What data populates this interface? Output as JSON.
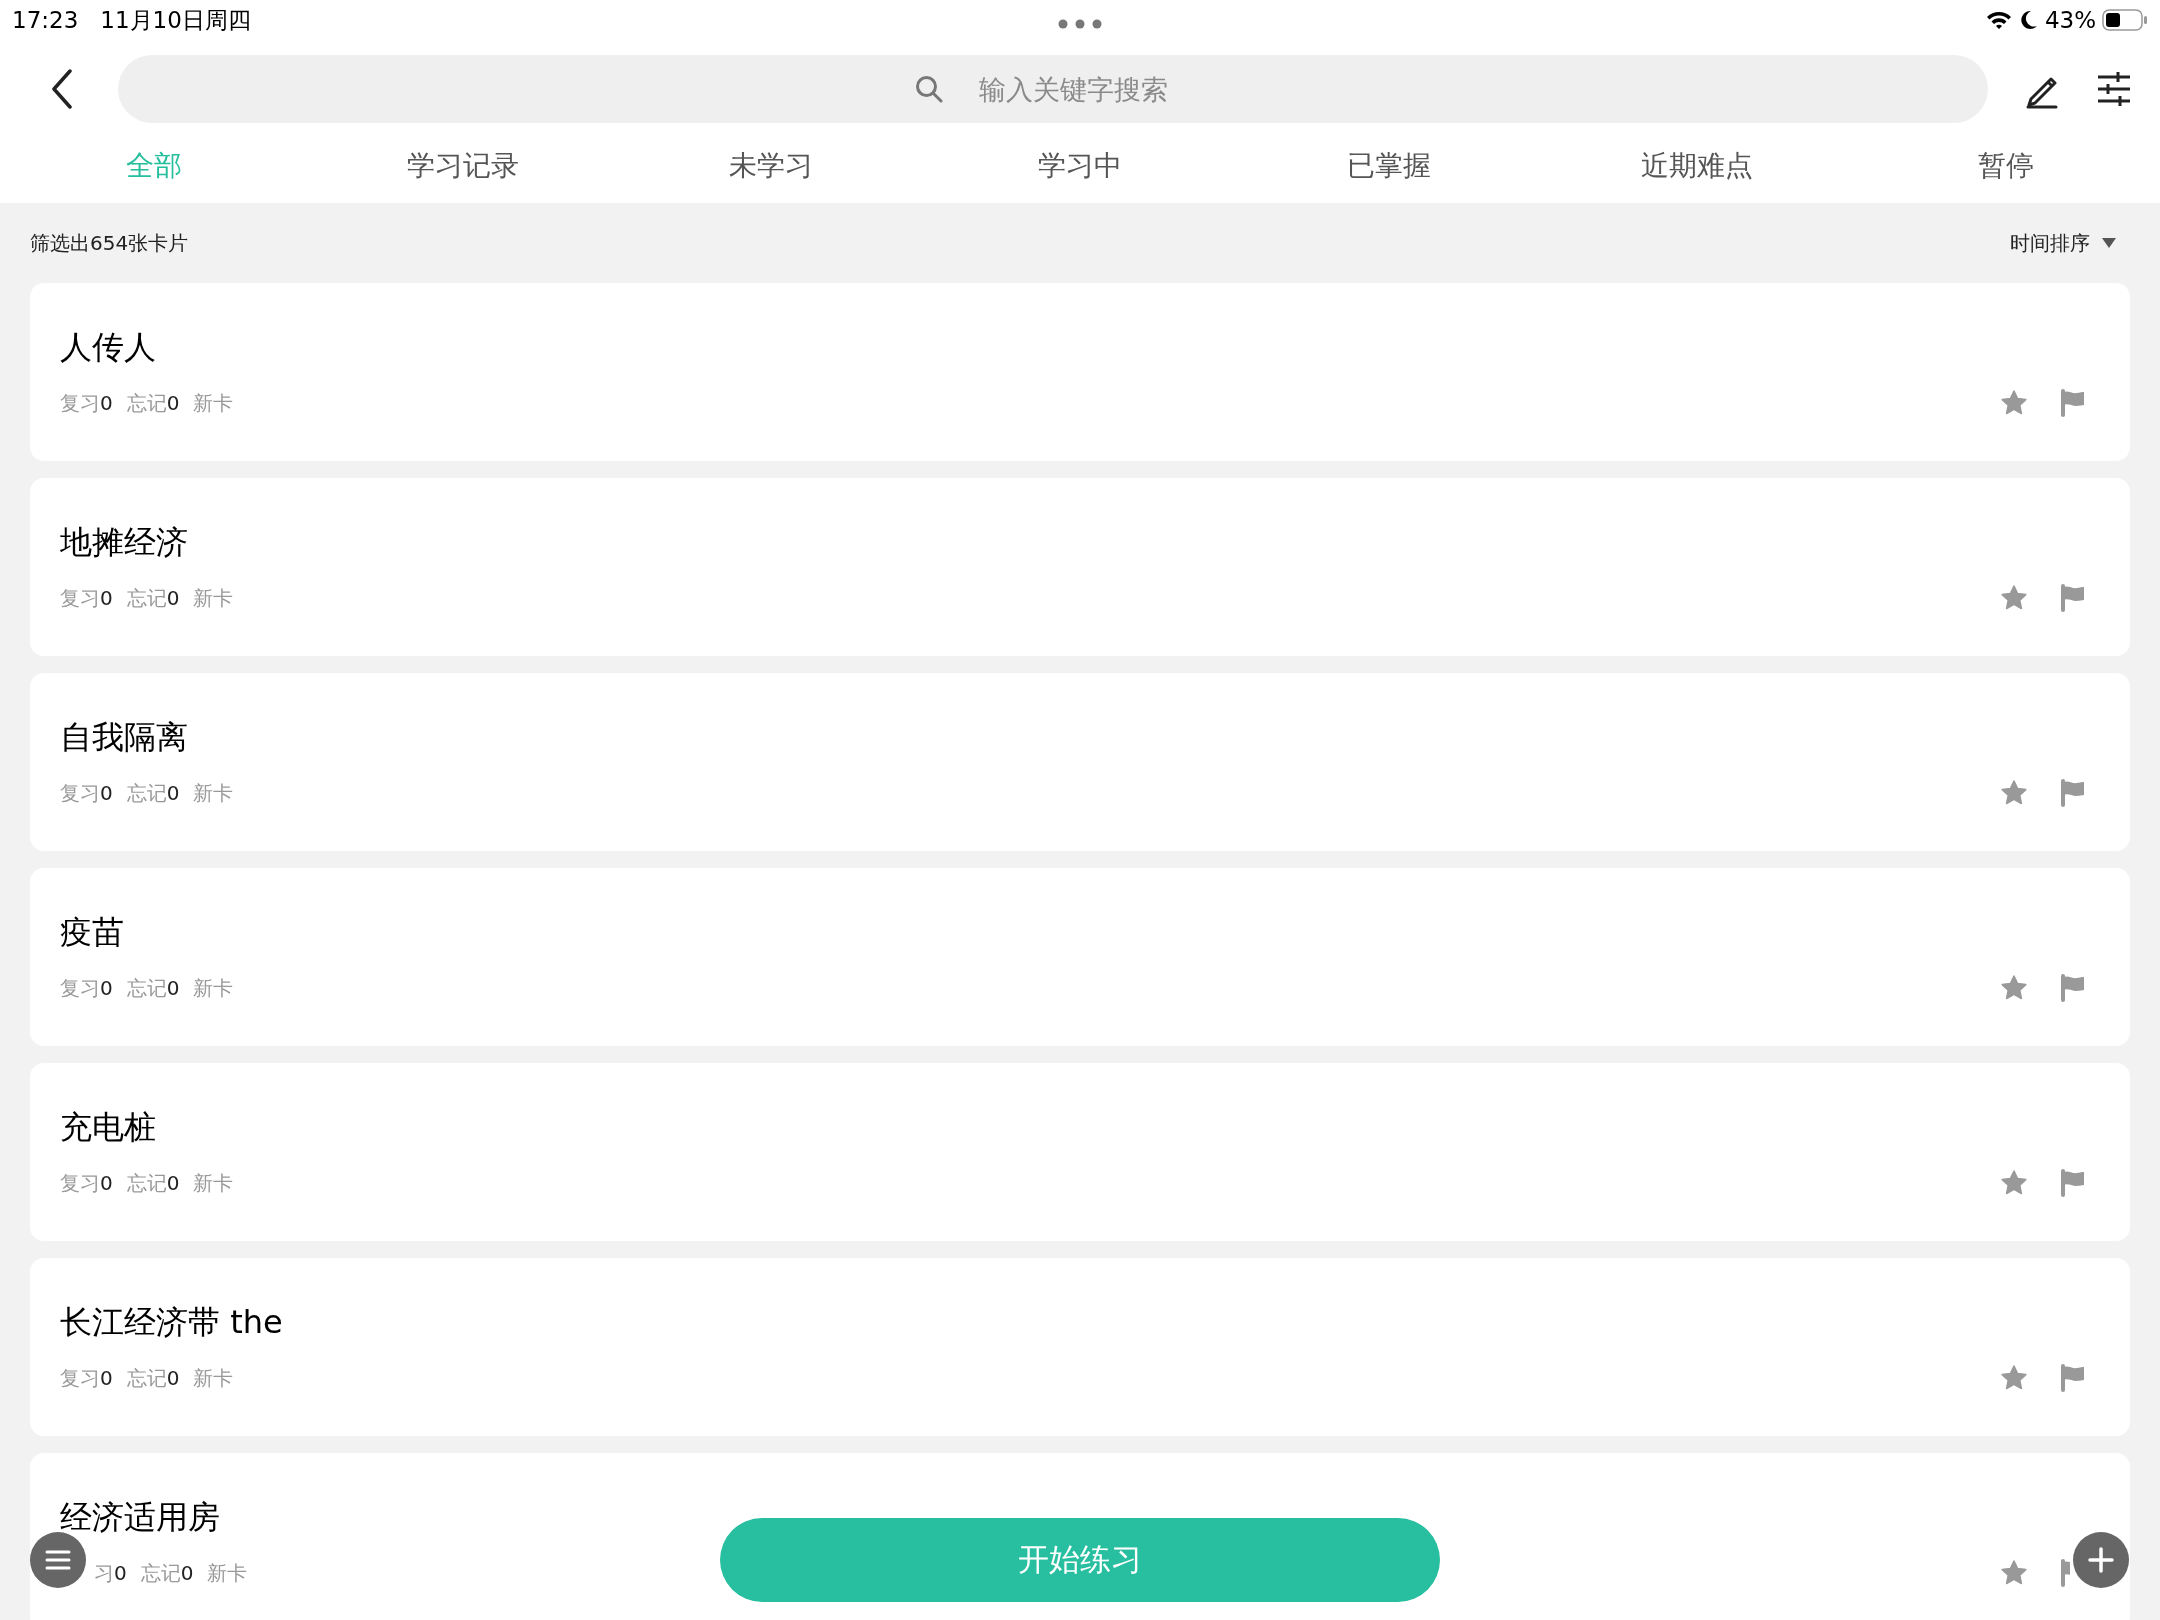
{
  "status_bar": {
    "time": "17:23",
    "date": "11月10日周四",
    "battery": "43%"
  },
  "search": {
    "placeholder": "输入关键字搜索"
  },
  "tabs": [
    {
      "label": "全部",
      "selected": true
    },
    {
      "label": "学习记录",
      "selected": false
    },
    {
      "label": "未学习",
      "selected": false
    },
    {
      "label": "学习中",
      "selected": false
    },
    {
      "label": "已掌握",
      "selected": false
    },
    {
      "label": "近期难点",
      "selected": false
    },
    {
      "label": "暂停",
      "selected": false
    }
  ],
  "filter_summary": "筛选出654张卡片",
  "sort": "时间排序",
  "cards": [
    {
      "title": "人传人",
      "meta": [
        {
          "label": "复习",
          "value": "0"
        },
        {
          "label": "忘记",
          "value": "0"
        },
        {
          "label": "新卡"
        }
      ]
    },
    {
      "title": "地摊经济",
      "meta": [
        {
          "label": "复习",
          "value": "0"
        },
        {
          "label": "忘记",
          "value": "0"
        },
        {
          "label": "新卡"
        }
      ]
    },
    {
      "title": "自我隔离",
      "meta": [
        {
          "label": "复习",
          "value": "0"
        },
        {
          "label": "忘记",
          "value": "0"
        },
        {
          "label": "新卡"
        }
      ]
    },
    {
      "title": "疫苗",
      "meta": [
        {
          "label": "复习",
          "value": "0"
        },
        {
          "label": "忘记",
          "value": "0"
        },
        {
          "label": "新卡"
        }
      ]
    },
    {
      "title": "充电桩",
      "meta": [
        {
          "label": "复习",
          "value": "0"
        },
        {
          "label": "忘记",
          "value": "0"
        },
        {
          "label": "新卡"
        }
      ]
    },
    {
      "title": "长江经济带 the",
      "meta": [
        {
          "label": "复习",
          "value": "0"
        },
        {
          "label": "忘记",
          "value": "0"
        },
        {
          "label": "新卡"
        }
      ]
    },
    {
      "title": "经济适用房",
      "meta": [
        {
          "label": "习",
          "value": "0"
        },
        {
          "label": "忘记",
          "value": "0"
        },
        {
          "label": "新卡"
        }
      ]
    }
  ],
  "start_button": "开始练习"
}
